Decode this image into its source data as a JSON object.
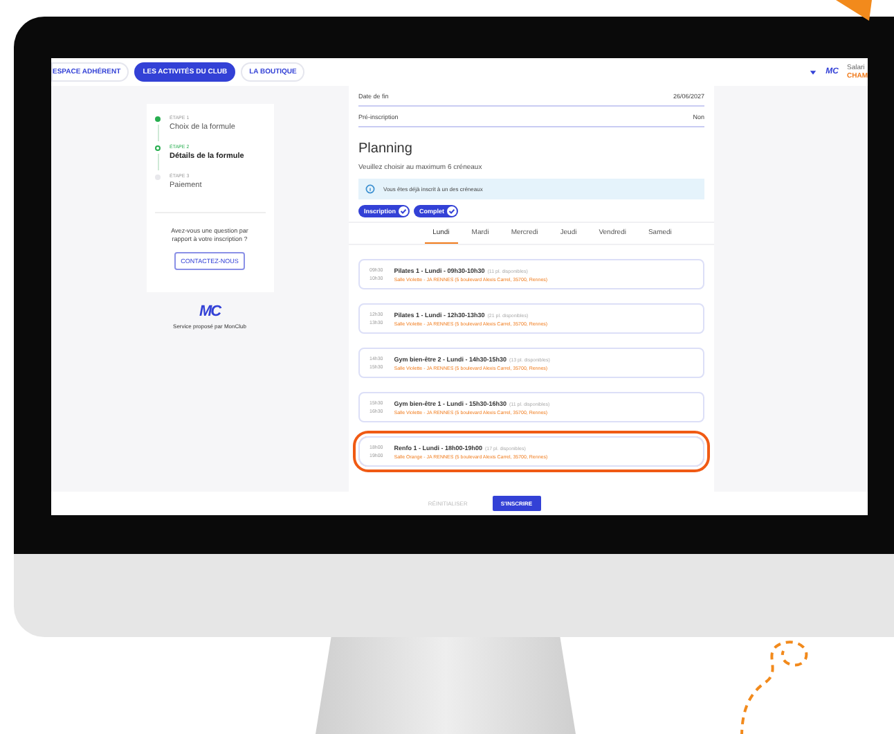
{
  "nav": {
    "tabs": [
      {
        "label": "ESPACE ADHÉRENT",
        "selected": false
      },
      {
        "label": "LES ACTIVITÉS DU CLUB",
        "selected": true
      },
      {
        "label": "LA BOUTIQUE",
        "selected": false
      }
    ],
    "logo_text": "MC",
    "user_name": "Salari",
    "user_club": "CHAM"
  },
  "stepper": {
    "steps": [
      {
        "step": "ÉTAPE 1",
        "label": "Choix de la formule",
        "done": true,
        "current": false
      },
      {
        "step": "ÉTAPE 2",
        "label": "Détails de la formule",
        "done": false,
        "current": true
      },
      {
        "step": "ÉTAPE 3",
        "label": "Paiement",
        "done": false,
        "current": false
      }
    ],
    "question": "Avez-vous une question par rapport à votre inscription ?",
    "contact_button": "CONTACTEZ-NOUS",
    "logo_text": "MC",
    "credit": "Service proposé par MonClub"
  },
  "fields": [
    {
      "label": "Date de fin",
      "value": "26/06/2027"
    },
    {
      "label": "Pré-inscription",
      "value": "Non"
    }
  ],
  "planning": {
    "title": "Planning",
    "subtitle": "Veuillez choisir au maximum 6 créneaux",
    "info": "Vous êtes déjà inscrit à un des créneaux",
    "tags": [
      "Inscription",
      "Complet"
    ],
    "days": [
      {
        "label": "Lundi",
        "selected": true
      },
      {
        "label": "Mardi",
        "selected": false
      },
      {
        "label": "Mercredi",
        "selected": false
      },
      {
        "label": "Jeudi",
        "selected": false
      },
      {
        "label": "Vendredi",
        "selected": false
      },
      {
        "label": "Samedi",
        "selected": false
      }
    ],
    "sessions": [
      {
        "start": "09h30",
        "end": "10h30",
        "title": "Pilates 1 - Lundi - 09h30-10h30",
        "places": "(11 pl. disponibles)",
        "room": "Salle Violette - JA RENNES (5 boulevard Alexis Carrel, 35700, Rennes)",
        "highlighted": false
      },
      {
        "start": "12h30",
        "end": "13h30",
        "title": "Pilates 1 - Lundi - 12h30-13h30",
        "places": "(21 pl. disponibles)",
        "room": "Salle Violette - JA RENNES (5 boulevard Alexis Carrel, 35700, Rennes)",
        "highlighted": false
      },
      {
        "start": "14h30",
        "end": "15h30",
        "title": "Gym bien-être 2 - Lundi - 14h30-15h30",
        "places": "(13 pl. disponibles)",
        "room": "Salle Violette - JA RENNES (5 boulevard Alexis Carrel, 35700, Rennes)",
        "highlighted": false
      },
      {
        "start": "15h30",
        "end": "16h30",
        "title": "Gym bien-être 1 - Lundi - 15h30-16h30",
        "places": "(11 pl. disponibles)",
        "room": "Salle Violette - JA RENNES (5 boulevard Alexis Carrel, 35700, Rennes)",
        "highlighted": false
      },
      {
        "start": "18h00",
        "end": "19h00",
        "title": "Renfo 1 - Lundi - 18h00-19h00",
        "places": "(17 pl. disponibles)",
        "room": "Salle Orange - JA RENNES (5 boulevard Alexis Carrel, 35700, Rennes)",
        "highlighted": true
      }
    ]
  },
  "footer": {
    "reset_button": "RÉINITIALISER",
    "submit_button": "S'INSCRIRE"
  }
}
